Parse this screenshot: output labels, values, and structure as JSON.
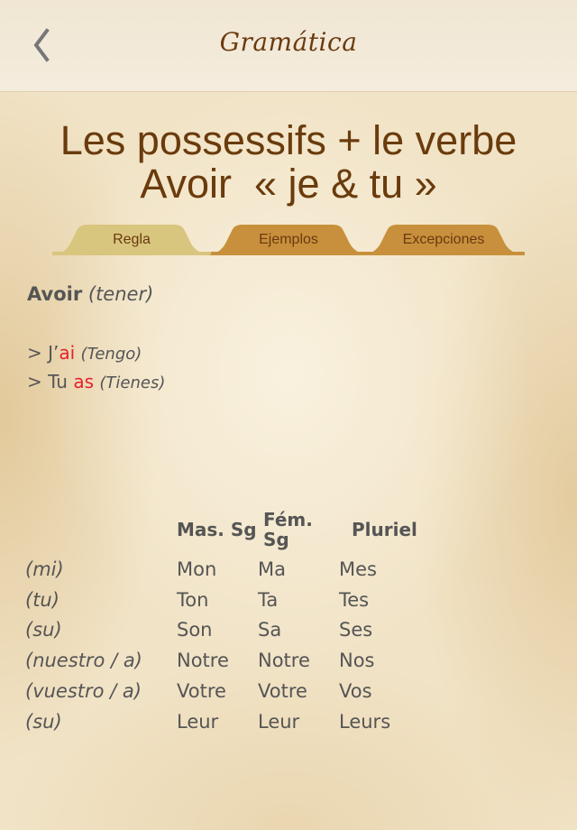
{
  "navbar": {
    "title": "Gramática",
    "back_icon": "chevron-left-icon"
  },
  "heading": {
    "line1": "Les possessifs + le verbe",
    "line2": "Avoir  « je & tu »"
  },
  "tabs": [
    {
      "label": "Regla",
      "color": "#d8c57e",
      "selected": true
    },
    {
      "label": "Ejemplos",
      "color": "#c8903c",
      "selected": false
    },
    {
      "label": "Excepciones",
      "color": "#c8903c",
      "selected": false
    }
  ],
  "content": {
    "verb": "Avoir",
    "verb_translation": "(tener)",
    "examples": [
      {
        "prefix": "> J’",
        "verb": "ai",
        "translation": "(Tengo)"
      },
      {
        "prefix": "> Tu ",
        "verb": "as",
        "translation": "(Tienes)"
      }
    ],
    "highlight_color": "#e3222b"
  },
  "table": {
    "headers": [
      "",
      "Mas. Sg",
      "Fém. Sg",
      "Pluriel"
    ],
    "rows": [
      [
        "(mi)",
        "Mon",
        "Ma",
        "Mes"
      ],
      [
        "(tu)",
        "Ton",
        "Ta",
        "Tes"
      ],
      [
        "(su)",
        "Son",
        "Sa",
        "Ses"
      ],
      [
        "(nuestro / a)",
        "Notre",
        "Notre",
        "Nos"
      ],
      [
        "(vuestro / a)",
        "Votre",
        "Votre",
        "Vos"
      ],
      [
        "(su)",
        "Leur",
        "Leur",
        "Leurs"
      ]
    ]
  }
}
